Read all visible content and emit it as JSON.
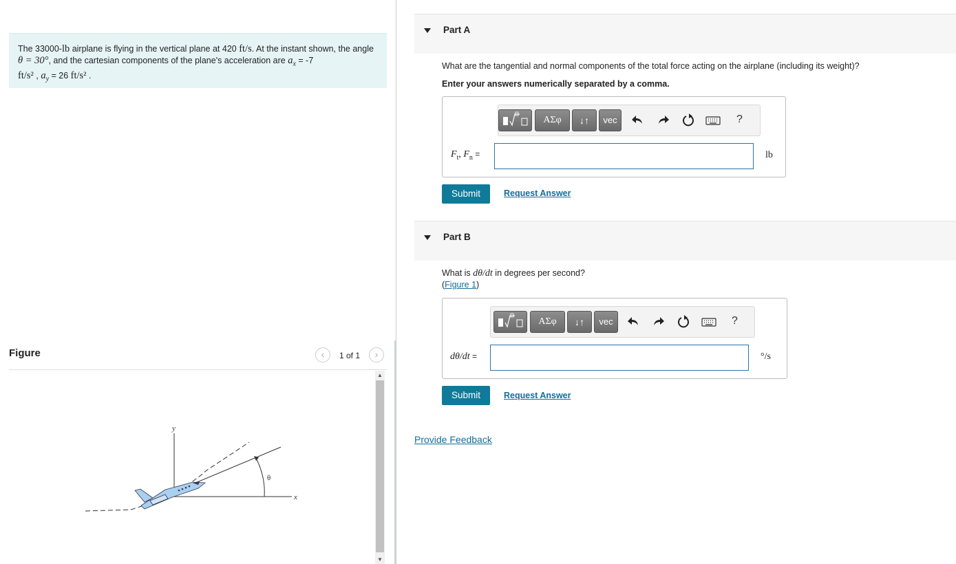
{
  "problem": {
    "text_1": "The 33000-",
    "unit_lb": "lb",
    "text_2": " airplane is flying in the vertical plane at 420 ",
    "unit_fts": "ft/s",
    "text_3": ". At the instant shown, the angle ",
    "theta_expr": "θ = 30°",
    "text_4": ", and the cartesian components of the plane's acceleration are ",
    "ax_sym": "a",
    "ax_sub": "x",
    "ax_val": " = -7",
    "unit_fts2_a": "ft/s²",
    "text_5": " , ",
    "ay_sym": "a",
    "ay_sub": "y",
    "ay_val": " = 26 ",
    "unit_fts2_b": "ft/s²",
    "text_6": " ."
  },
  "figure": {
    "title": "Figure",
    "pager": "1 of 1",
    "prev_icon": "‹",
    "next_icon": "›",
    "labels": {
      "y": "y",
      "x": "x",
      "theta": "θ"
    }
  },
  "partA": {
    "title": "Part A",
    "question": "What are the tangential and normal components of the total force acting on the airplane (including its weight)?",
    "instruction": "Enter your answers numerically separated by a comma.",
    "label": "Ft, Fn =",
    "label_F1": "F",
    "label_t": "t",
    "label_comma": ", ",
    "label_F2": "F",
    "label_n": "n",
    "label_eq": " =",
    "unit": "lb",
    "submit": "Submit",
    "request": "Request Answer"
  },
  "partB": {
    "title": "Part B",
    "q_pre": "What is ",
    "q_expr": "dθ/dt",
    "q_post": " in degrees per second?",
    "fig_open": "(",
    "fig_link": "Figure 1",
    "fig_close": ")",
    "label": "dθ/dt =",
    "label_expr": "dθ/dt",
    "label_eq": " =",
    "unit": "°/s",
    "submit": "Submit",
    "request": "Request Answer"
  },
  "toolbar": {
    "templates_icon": "fraction-sqrt-icon",
    "greek": "ΑΣφ",
    "arrows": "↓↑",
    "vec": "vec",
    "help": "?",
    "undo_icon": "undo-icon",
    "redo_icon": "redo-icon",
    "reset_icon": "reset-icon",
    "keyboard_icon": "keyboard-icon"
  },
  "feedback": "Provide Feedback"
}
